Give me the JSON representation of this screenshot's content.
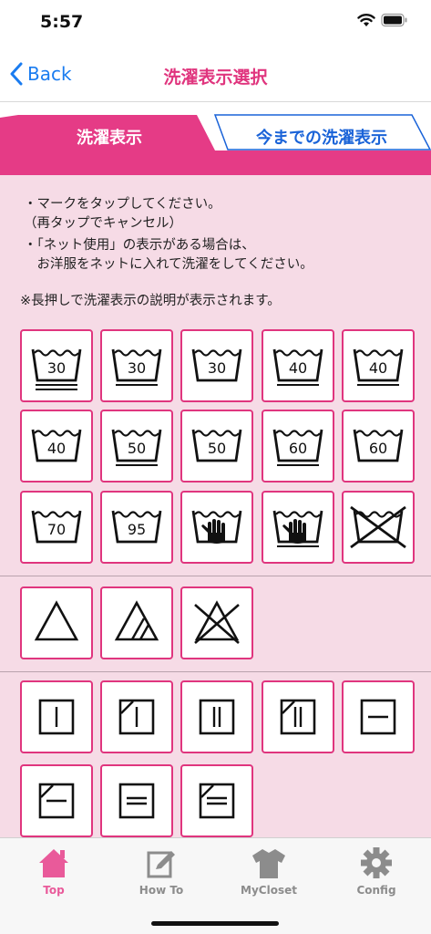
{
  "status_bar": {
    "time": "5:57"
  },
  "nav": {
    "back_label": "Back",
    "title": "洗濯表示選択"
  },
  "tabs": {
    "active_label": "洗濯表示",
    "inactive_label": "今までの洗濯表示"
  },
  "instructions": {
    "lines": [
      "・マークをタップしてください。",
      "（再タップでキャンセル）",
      "・「ネット使用」の表示がある場合は、",
      "　お洋服をネットに入れて洗濯をしてください。"
    ],
    "note": "※長押しで洗濯表示の説明が表示されます。"
  },
  "symbols": {
    "wash": [
      {
        "icon": "wash-tub-30-very-mild-icon",
        "temp": "30"
      },
      {
        "icon": "wash-tub-30-mild-icon",
        "temp": "30"
      },
      {
        "icon": "wash-tub-30-icon",
        "temp": "30"
      },
      {
        "icon": "wash-tub-40-mild-icon",
        "temp": "40"
      },
      {
        "icon": "wash-tub-40-mild-icon",
        "temp": "40"
      },
      {
        "icon": "wash-tub-40-icon",
        "temp": "40"
      },
      {
        "icon": "wash-tub-50-mild-icon",
        "temp": "50"
      },
      {
        "icon": "wash-tub-50-icon",
        "temp": "50"
      },
      {
        "icon": "wash-tub-60-mild-icon",
        "temp": "60"
      },
      {
        "icon": "wash-tub-60-icon",
        "temp": "60"
      },
      {
        "icon": "wash-tub-70-icon",
        "temp": "70"
      },
      {
        "icon": "wash-tub-95-icon",
        "temp": "95"
      },
      {
        "icon": "hand-wash-icon",
        "temp": ""
      },
      {
        "icon": "hand-wash-mild-icon",
        "temp": ""
      },
      {
        "icon": "do-not-wash-icon",
        "temp": ""
      }
    ],
    "bleach": [
      {
        "icon": "bleach-allowed-icon"
      },
      {
        "icon": "oxygen-bleach-only-icon"
      },
      {
        "icon": "do-not-bleach-icon"
      }
    ],
    "dry": [
      {
        "icon": "hang-dry-icon"
      },
      {
        "icon": "hang-dry-shade-icon"
      },
      {
        "icon": "drip-dry-icon"
      },
      {
        "icon": "drip-dry-shade-icon"
      },
      {
        "icon": "flat-dry-icon"
      },
      {
        "icon": "flat-dry-shade-icon"
      },
      {
        "icon": "drip-flat-dry-icon"
      },
      {
        "icon": "drip-flat-dry-shade-icon"
      }
    ]
  },
  "bottom_tabs": [
    {
      "label": "Top",
      "icon": "home-icon",
      "active": true
    },
    {
      "label": "How To",
      "icon": "edit-note-icon",
      "active": false
    },
    {
      "label": "MyCloset",
      "icon": "tshirt-icon",
      "active": false
    },
    {
      "label": "Config",
      "icon": "gear-icon",
      "active": false
    }
  ],
  "colors": {
    "accent": "#e53b86",
    "title": "#e0357e",
    "link": "#1a7cf0",
    "background": "#f6dbe6"
  }
}
